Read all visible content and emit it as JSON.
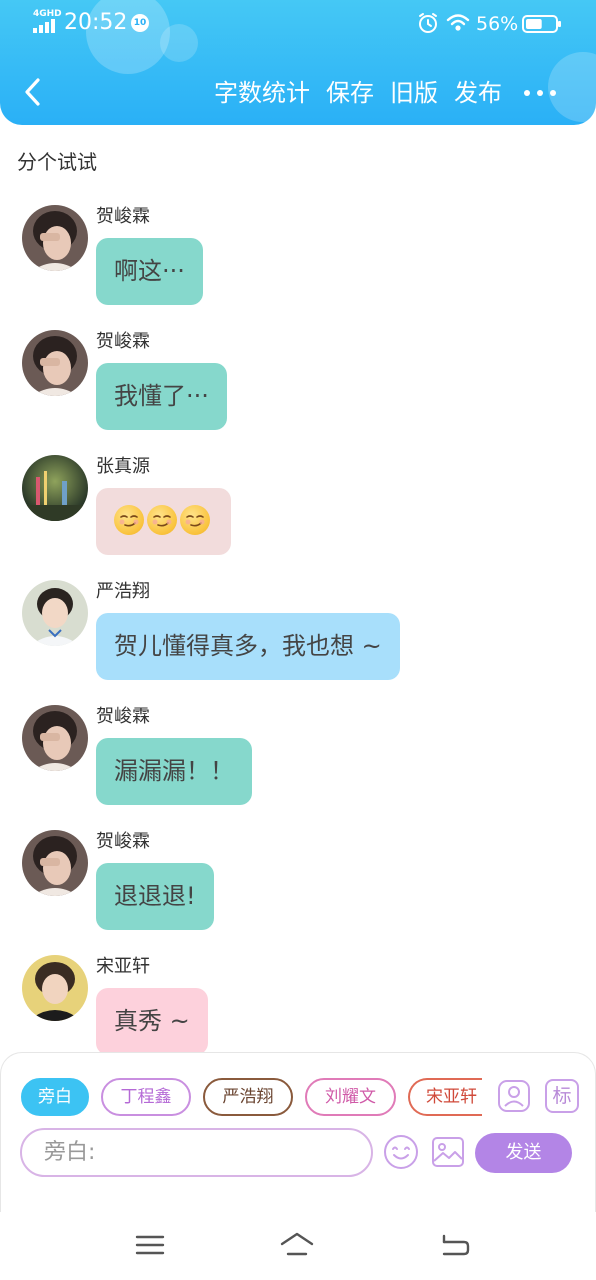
{
  "status_bar": {
    "network": "4GHD",
    "time": "20:52",
    "notification_badge": "10",
    "battery": "56%",
    "battery_level": 0.56
  },
  "nav": {
    "back_icon": "chevron-left-icon",
    "actions": {
      "word_count": "字数统计",
      "save": "保存",
      "old_version": "旧版",
      "publish": "发布"
    },
    "more_icon": "more-dots-icon"
  },
  "story": {
    "title": "分个试试"
  },
  "messages": [
    {
      "sender": "贺峻霖",
      "text": "啊这···",
      "bubble_color": "#86d8cc"
    },
    {
      "sender": "贺峻霖",
      "text": "我懂了···",
      "bubble_color": "#86d8cc"
    },
    {
      "sender": "张真源",
      "text": "",
      "emoji": [
        "smirk-emoji",
        "smirk-emoji",
        "smirk-emoji"
      ],
      "bubble_color": "#f2dcdc"
    },
    {
      "sender": "严浩翔",
      "text": "贺儿懂得真多，我也想 ~",
      "bubble_color": "#a8dffb"
    },
    {
      "sender": "贺峻霖",
      "text": "漏漏漏！！",
      "bubble_color": "#86d8cc"
    },
    {
      "sender": "贺峻霖",
      "text": "退退退!",
      "bubble_color": "#86d8cc"
    },
    {
      "sender": "宋亚轩",
      "text": "真秀 ~",
      "bubble_color": "#fdd1dc"
    }
  ],
  "composer": {
    "roles": [
      {
        "label": "旁白",
        "selected": true,
        "color": "#3cc3f3"
      },
      {
        "label": "丁程鑫",
        "selected": false,
        "color": "#c98fe0"
      },
      {
        "label": "严浩翔",
        "selected": false,
        "color": "#8a5a3c"
      },
      {
        "label": "刘耀文",
        "selected": false,
        "color": "#e07bb8"
      },
      {
        "label": "宋亚轩",
        "selected": false,
        "color": "#e06a55"
      }
    ],
    "role_icon": "person-icon",
    "tag_label": "标",
    "input_placeholder": "旁白:",
    "emoji_icon": "smiley-icon",
    "image_icon": "image-icon",
    "send_label": "发送",
    "send_color": "#b385e6"
  },
  "system_nav": {
    "menu_icon": "menu-icon",
    "home_icon": "home-icon",
    "back_icon": "back-arrow-icon"
  },
  "colors": {
    "header_accent": "#2ab0f6"
  }
}
